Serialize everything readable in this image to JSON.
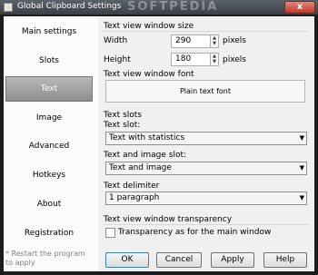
{
  "window": {
    "title": "Global Clipboard Settings",
    "watermark": "SOFTPEDIA",
    "close_glyph": "x"
  },
  "sidebar": {
    "items": [
      {
        "label": "Main settings"
      },
      {
        "label": "Slots"
      },
      {
        "label": "Text"
      },
      {
        "label": "Image"
      },
      {
        "label": "Advanced"
      },
      {
        "label": "Hotkeys"
      },
      {
        "label": "About"
      },
      {
        "label": "Registration"
      }
    ],
    "active": "Text",
    "footnote": "* Restart the program to apply"
  },
  "size_section": {
    "title": "Text view window size",
    "width_label": "Width",
    "width_value": "290",
    "height_label": "Height",
    "height_value": "180",
    "unit": "pixels"
  },
  "font_section": {
    "title": "Text view window font",
    "button_label": "Plain text font"
  },
  "slots_section": {
    "title": "Text slots",
    "text_slot_label": "Text slot:",
    "text_slot_value": "Text with statistics",
    "text_image_slot_label": "Text and image slot:",
    "text_image_slot_value": "Text and image"
  },
  "delimiter_section": {
    "title": "Text delimiter",
    "value": "1 paragraph"
  },
  "transparency_section": {
    "title": "Text view window transparency",
    "checkbox_label": "Transparency as for the main window",
    "checked": false
  },
  "buttons": {
    "ok": "OK",
    "cancel": "Cancel",
    "apply": "Apply",
    "help": "Help"
  }
}
